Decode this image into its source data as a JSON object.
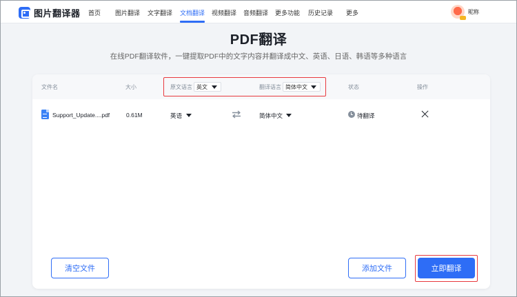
{
  "header": {
    "logo_text": "图片翻译器",
    "nav": [
      {
        "label": "首页"
      },
      {
        "label": "图片翻译"
      },
      {
        "label": "文字翻译"
      },
      {
        "label": "文档翻译",
        "active": true
      },
      {
        "label": "视频翻译"
      },
      {
        "label": "音频翻译"
      },
      {
        "label": "更多功能"
      },
      {
        "label": "历史记录"
      },
      {
        "label": "更多"
      }
    ],
    "user_name": "昵称"
  },
  "page": {
    "title": "PDF翻译",
    "subtitle": "在线PDF翻译软件，一键提取PDF中的文字内容并翻译成中文、英语、日语、韩语等多种语言"
  },
  "table": {
    "headers": {
      "file_name": "文件名",
      "size": "大小",
      "source_lang": "原文语言",
      "target_lang": "翻译语言",
      "status": "状态",
      "actions": "操作"
    },
    "header_source_select": "英文",
    "header_target_select": "简体中文",
    "rows": [
      {
        "file_name": "Support_Update....pdf",
        "size": "0.61M",
        "source_lang": "英语",
        "target_lang": "简体中文",
        "status": "待翻译"
      }
    ]
  },
  "buttons": {
    "clear": "清空文件",
    "add": "添加文件",
    "translate": "立即翻译"
  },
  "colors": {
    "accent": "#2e6df6",
    "highlight": "#e8383d",
    "background": "#f2f4f7"
  },
  "icons": [
    "logo-icon",
    "avatar",
    "file-icon",
    "swap-icon",
    "clock-icon",
    "close-icon",
    "caret-down-icon"
  ]
}
